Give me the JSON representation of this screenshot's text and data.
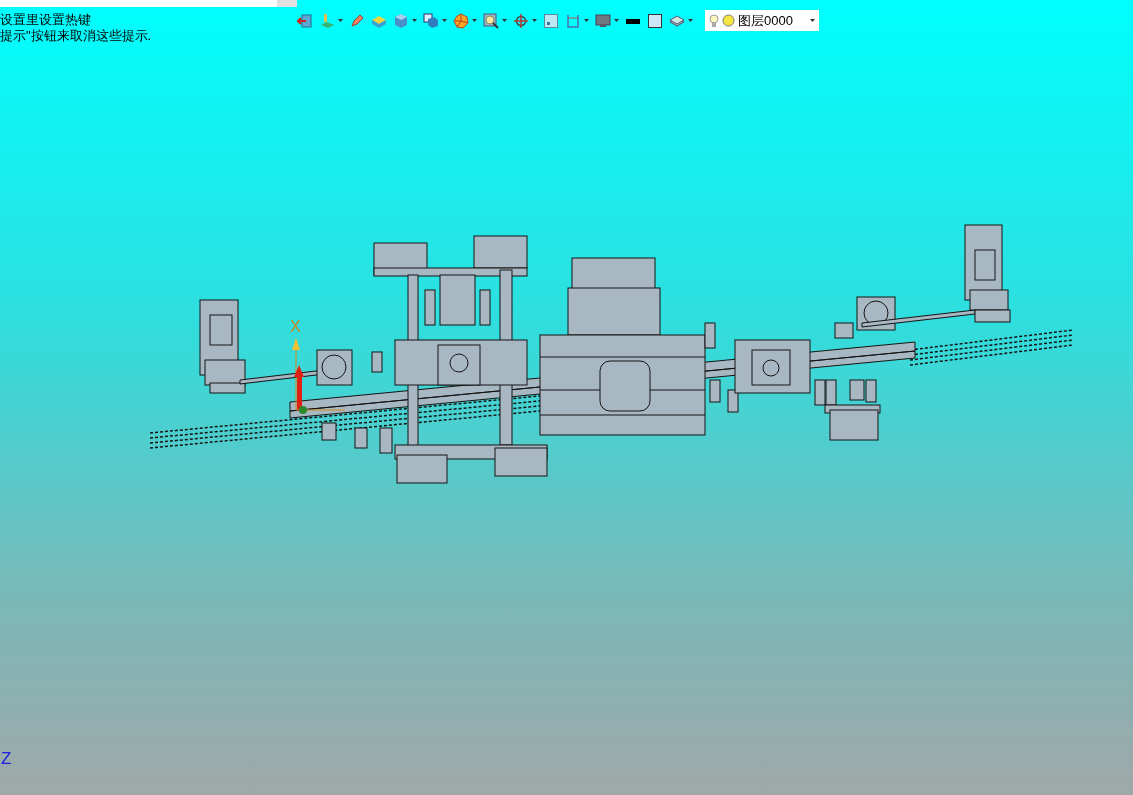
{
  "hints": [
    "设置里设置热键",
    "提示\"按钮来取消这些提示."
  ],
  "toolbar": [
    {
      "kind": "exit",
      "dropdown": false
    },
    {
      "kind": "plane",
      "dropdown": true
    },
    {
      "kind": "pencil",
      "dropdown": false
    },
    {
      "kind": "solid",
      "dropdown": false
    },
    {
      "kind": "cube",
      "dropdown": true
    },
    {
      "kind": "view",
      "dropdown": true
    },
    {
      "kind": "shade",
      "dropdown": true
    },
    {
      "kind": "zoom",
      "dropdown": true
    },
    {
      "kind": "target",
      "dropdown": true
    },
    {
      "kind": "frame",
      "dropdown": false
    },
    {
      "kind": "section",
      "dropdown": true
    },
    {
      "kind": "display",
      "dropdown": true
    },
    {
      "kind": "line",
      "dropdown": false
    },
    {
      "kind": "fill",
      "dropdown": false
    },
    {
      "kind": "layers",
      "dropdown": true
    }
  ],
  "layer": {
    "name": "图层0000"
  },
  "axes": {
    "x_label": "X",
    "z_label": "Z"
  }
}
